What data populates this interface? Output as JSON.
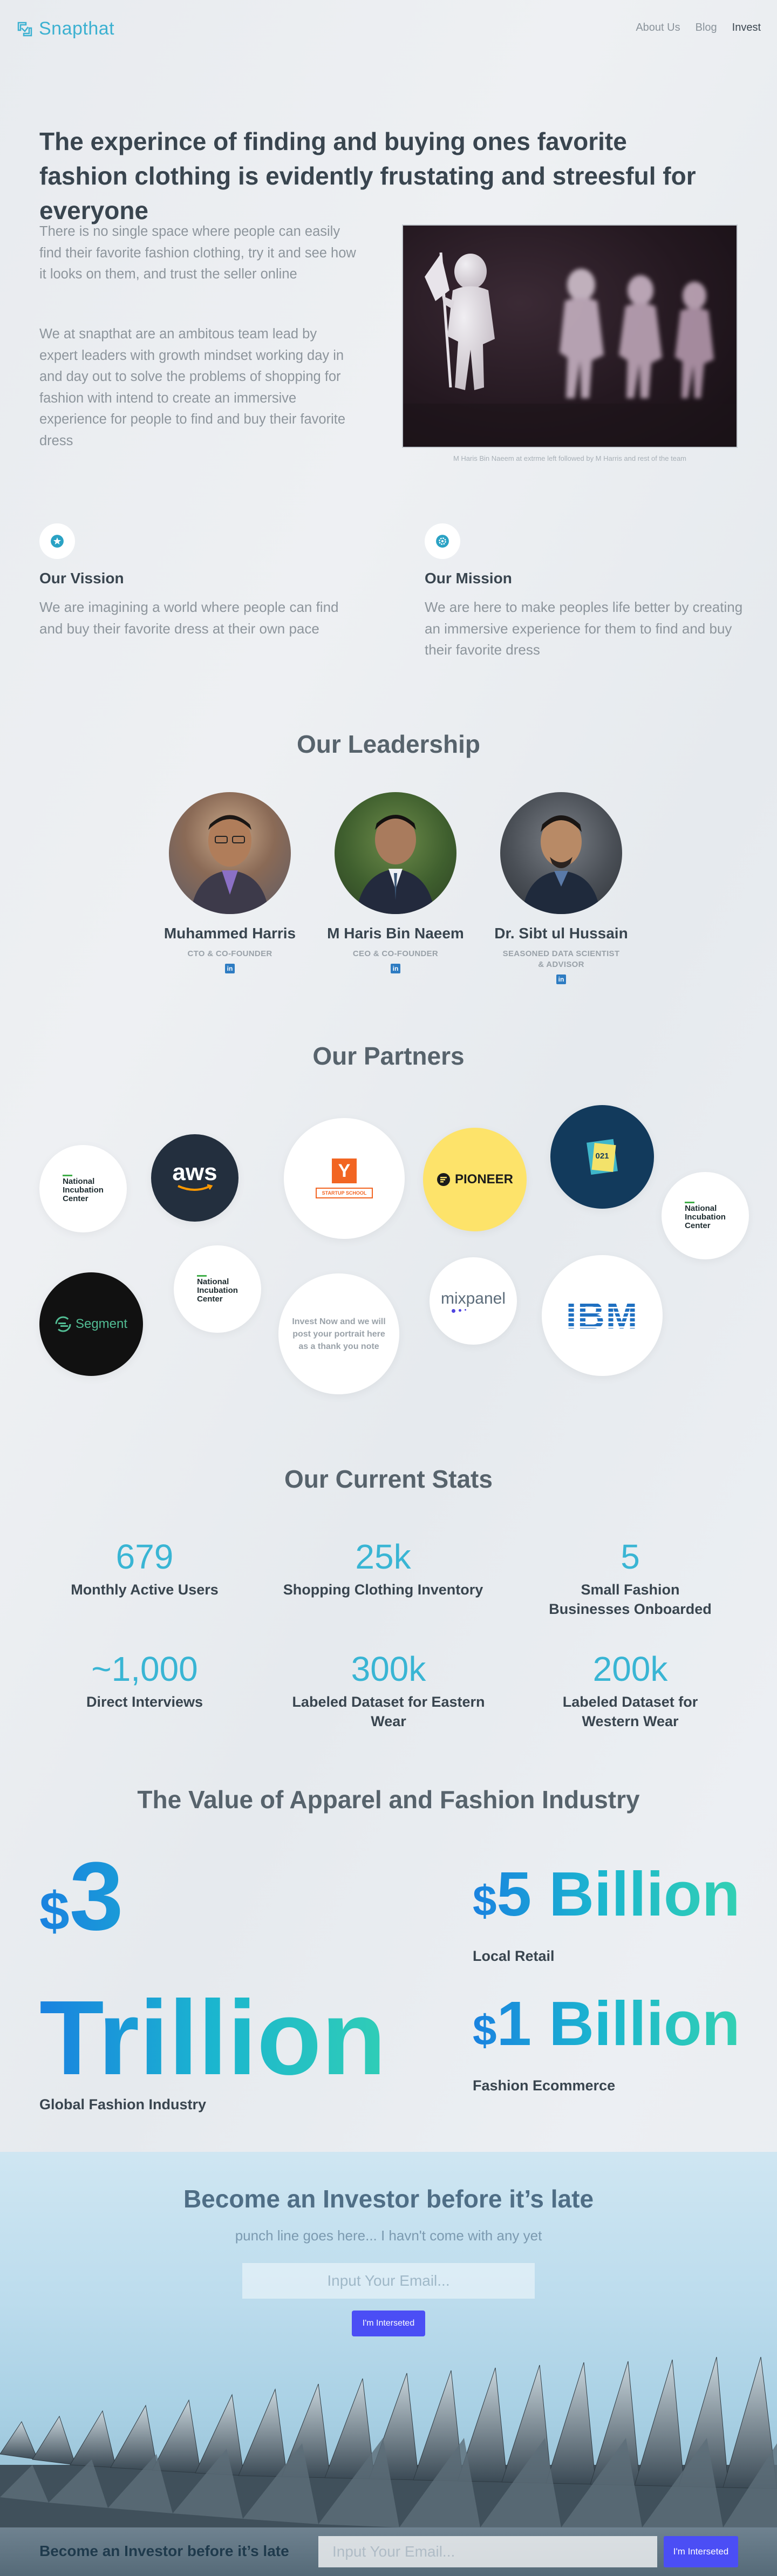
{
  "brand": {
    "name": "Snapthat",
    "accent": "#3cb1d1"
  },
  "nav": {
    "items": [
      {
        "label": "About Us",
        "active": false
      },
      {
        "label": "Blog",
        "active": false
      },
      {
        "label": "Invest",
        "active": true
      }
    ]
  },
  "hero": {
    "title": "The experince of finding and buying ones favorite fashion clothing is evidently frustating and streesful for everyone",
    "para1": "There is no single space where people can easily find their favorite fashion clothing, try it and see how it looks on them, and trust the seller online",
    "para2": "We at snapthat are an ambitous team lead by expert leaders with growth mindset working day in and day out to solve the problems of shopping for fashion with intend to create an immersive experience for people to find and buy their favorite dress",
    "image_caption": "M Haris Bin Naeem at extrme left followed by M Harris and rest of the team"
  },
  "vision": {
    "icon": "star-icon",
    "title": "Our Vission",
    "text": "We are imagining a world where people can find and buy their favorite dress at their own pace"
  },
  "mission": {
    "icon": "gear-icon",
    "title": "Our Mission",
    "text": "We are here to make peoples life better by creating an immersive experience for them to find and buy their favorite dress"
  },
  "leadership": {
    "title": "Our Leadership",
    "people": [
      {
        "name": "Muhammed Harris",
        "role": "CTO & CO-FOUNDER",
        "role2": ""
      },
      {
        "name": "M Haris Bin Naeem",
        "role": "CEO & CO-FOUNDER",
        "role2": ""
      },
      {
        "name": "Dr. Sibt ul Hussain",
        "role": "SEASONED DATA SCIENTIST",
        "role2": "& ADVISOR"
      }
    ],
    "linkedin_glyph": "in"
  },
  "partners": {
    "title": "Our Partners",
    "nic": {
      "line1": "National",
      "line2": "Incubation",
      "line3": "Center"
    },
    "aws": "aws",
    "yc_letter": "Y",
    "yc_label": "STARTUP SCHOOL",
    "pioneer": "PIONEER",
    "plan9_label": "021",
    "segment": "Segment",
    "mixpanel": "mixpanel",
    "ibm": "IBM",
    "invest_note": "Invest Now and we will post your portrait here as a thank you note"
  },
  "stats": {
    "title": "Our Current Stats",
    "items": [
      {
        "value": "679",
        "label": "Monthly Active Users"
      },
      {
        "value": "25k",
        "label": "Shopping Clothing Inventory"
      },
      {
        "value": "5",
        "label": "Small Fashion Businesses Onboarded"
      },
      {
        "value": "~1,000",
        "label": "Direct Interviews"
      },
      {
        "value": "300k",
        "label": "Labeled Dataset for Eastern Wear"
      },
      {
        "value": "200k",
        "label": "Labeled Dataset for Western Wear"
      }
    ]
  },
  "value": {
    "title": "The Value of Apparel and Fashion Industry",
    "global_currency": "$",
    "global_number": "3",
    "global_unit": "Trillion",
    "global_label": "Global Fashion Industry",
    "local_currency": "$",
    "local_amount": "5 Billion",
    "local_label": "Local Retail",
    "ecom_currency": "$",
    "ecom_amount": "1 Billion",
    "ecom_label": "Fashion Ecommerce"
  },
  "investor": {
    "title": "Become an Investor before it’s late",
    "subtitle": "punch line goes here... I havn't come with any yet",
    "email_placeholder": "Input Your Email...",
    "button": "I'm Interseted"
  },
  "sticky": {
    "label": "Become an Investor before it’s late",
    "email_placeholder": "Input Your Email...",
    "button": "I'm Interseted"
  }
}
